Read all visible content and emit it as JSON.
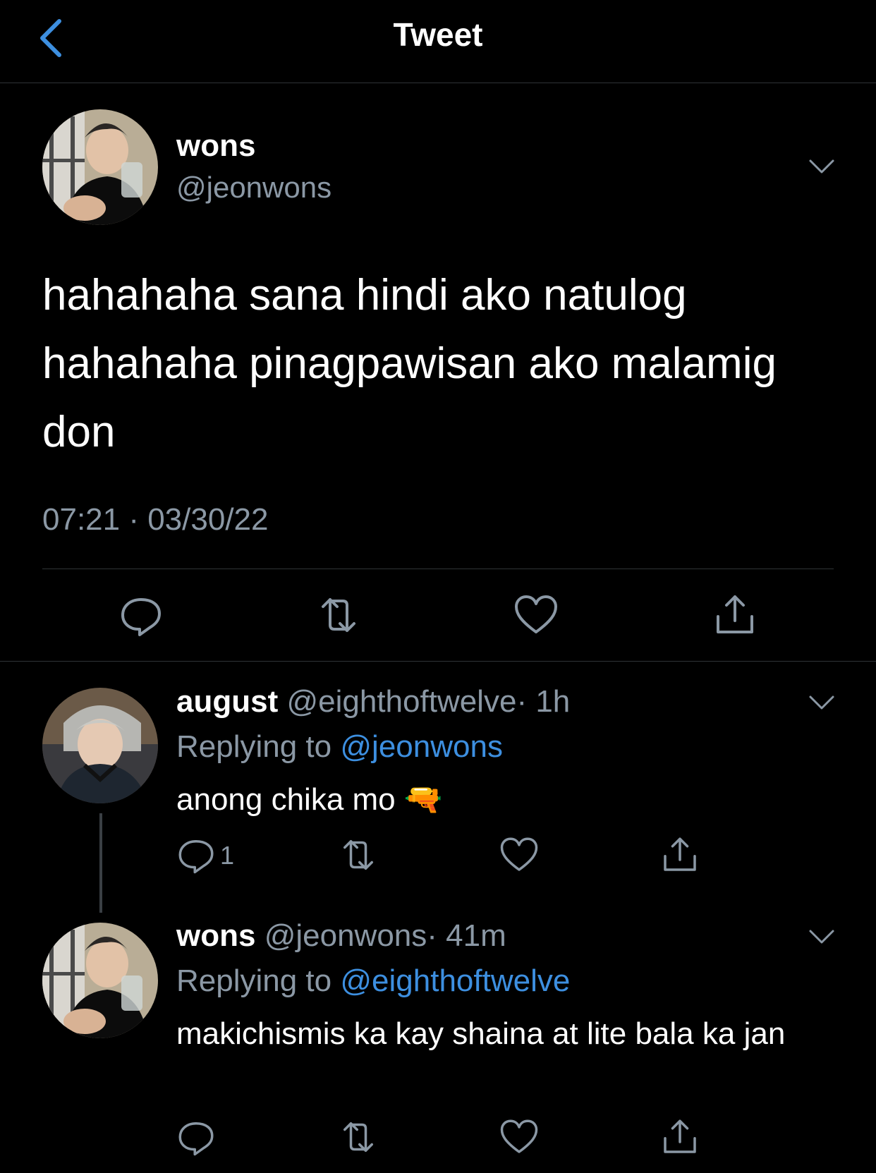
{
  "header": {
    "title": "Tweet"
  },
  "main_tweet": {
    "name": "wons",
    "handle": "@jeonwons",
    "text": "hahahaha sana hindi ako natulog hahahaha pinagpawisan ako malamig don",
    "timestamp": "07:21 · 03/30/22"
  },
  "replies": [
    {
      "name": "august",
      "handle": "@eighthoftwelve",
      "time": "· 1h",
      "replying_label": "Replying to",
      "replying_to": "@jeonwons",
      "text": "anong chika mo",
      "emoji": "🔫",
      "reply_count": "1"
    },
    {
      "name": "wons",
      "handle": "@jeonwons",
      "time": "· 41m",
      "replying_label": "Replying to",
      "replying_to": "@eighthoftwelve",
      "text": "makichismis ka kay shaina at lite bala ka jan",
      "reply_count": ""
    }
  ],
  "colors": {
    "background": "#000000",
    "text": "#ffffff",
    "muted": "#8b98a5",
    "link": "#3d8fe0",
    "divider": "#2f3336"
  },
  "icons": [
    "back-chevron-icon",
    "chevron-down-icon",
    "reply-icon",
    "retweet-icon",
    "like-icon",
    "share-icon"
  ]
}
